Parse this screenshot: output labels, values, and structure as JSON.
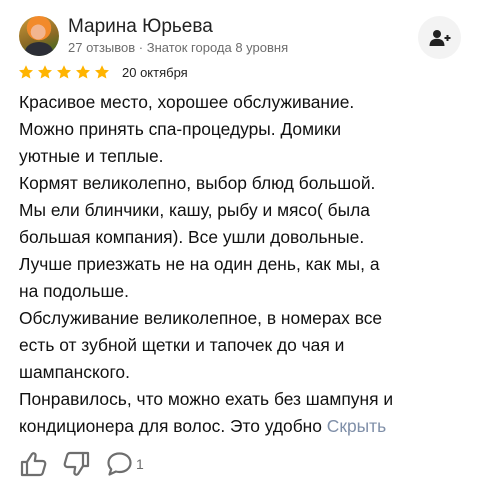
{
  "reviewer": {
    "name": "Марина Юрьева",
    "meta": "27 отзывов · Знаток города 8 уровня"
  },
  "rating": {
    "stars": 5,
    "max": 5,
    "color": "#ffb400"
  },
  "date": "20 октября",
  "review_lines": [
    "Красивое место, хорошее обслуживание.",
    "Можно принять спа-процедуры. Домики",
    "уютные и теплые.",
    "Кормят великолепно, выбор блюд большой.",
    "Мы ели блинчики, кашу, рыбу и мясо( была",
    "большая компания). Все ушли довольные.",
    "Лучше приезжать не на один день, как мы, а",
    "на подольше.",
    "Обслуживание великолепное, в номерах все",
    "есть от зубной щетки и тапочек до чая и",
    "шампанского.",
    "Понравилось, что можно ехать без шампуня и",
    "кондиционера для волос. Это удобно"
  ],
  "hide_link": "Скрыть",
  "actions": {
    "comments_count": "1"
  },
  "icons": [
    "add-user-icon",
    "star-icon",
    "thumbs-up-icon",
    "thumbs-down-icon",
    "comment-icon"
  ]
}
